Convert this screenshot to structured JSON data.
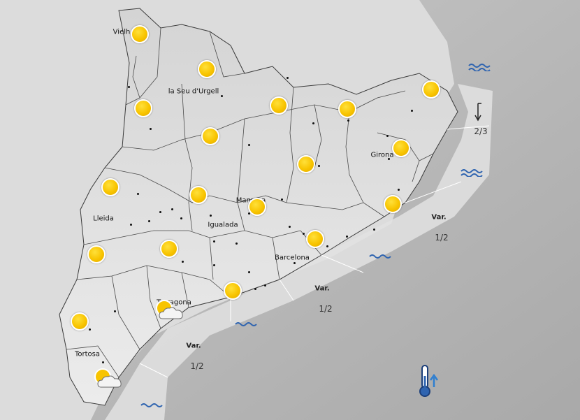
{
  "map": {
    "colors": {
      "land": "#e6e6e6",
      "sea": "#bdbdbd",
      "coastal_band": "#e9e9e9",
      "border": "#4a4a4a",
      "wave": "#2f64b0",
      "sun": "#f8c400"
    },
    "cities": [
      {
        "name": "Vielh"
      },
      {
        "name": "la Seu d'Urgell"
      },
      {
        "name": "Girona"
      },
      {
        "name": "Lleida"
      },
      {
        "name": "Manresa"
      },
      {
        "name": "Igualada"
      },
      {
        "name": "Barcelona"
      },
      {
        "name": "Tarragona"
      },
      {
        "name": "Tortosa"
      }
    ],
    "weather_symbols": {
      "sunny": "sun-icon",
      "sun_cloud": "sun-behind-cloud-icon"
    },
    "sea_state": [
      {
        "direction_label": "Var.",
        "value": "1/2"
      },
      {
        "direction_label": "Var.",
        "value": "1/2"
      },
      {
        "direction_label": "Var.",
        "value": "1/2"
      },
      {
        "direction_label": "",
        "value": "2/3"
      }
    ],
    "wave_icon": "waves-icon",
    "wind_icon": "wind-arrow-icon",
    "temperature_icon": "thermometer-rising-icon"
  }
}
